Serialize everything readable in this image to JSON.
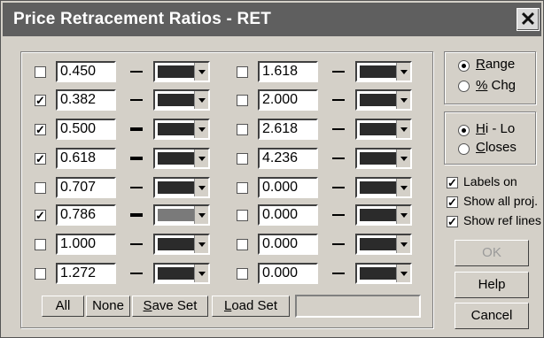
{
  "window": {
    "title": "Price Retracement Ratios - RET",
    "close_glyph": "✕"
  },
  "left_ratios": [
    {
      "checked": false,
      "value": "0.450",
      "line": "thin",
      "color": "#2b2b2b"
    },
    {
      "checked": true,
      "value": "0.382",
      "line": "thin",
      "color": "#2b2b2b"
    },
    {
      "checked": true,
      "value": "0.500",
      "line": "thick",
      "color": "#2b2b2b"
    },
    {
      "checked": true,
      "value": "0.618",
      "line": "thick",
      "color": "#2b2b2b"
    },
    {
      "checked": false,
      "value": "0.707",
      "line": "thin",
      "color": "#2b2b2b"
    },
    {
      "checked": true,
      "value": "0.786",
      "line": "thick",
      "color": "#7a7a7a"
    },
    {
      "checked": false,
      "value": "1.000",
      "line": "thin",
      "color": "#2b2b2b"
    },
    {
      "checked": false,
      "value": "1.272",
      "line": "thin",
      "color": "#2b2b2b"
    }
  ],
  "right_ratios": [
    {
      "checked": false,
      "value": "1.618",
      "line": "thin",
      "color": "#2b2b2b"
    },
    {
      "checked": false,
      "value": "2.000",
      "line": "thin",
      "color": "#2b2b2b"
    },
    {
      "checked": false,
      "value": "2.618",
      "line": "thin",
      "color": "#2b2b2b"
    },
    {
      "checked": false,
      "value": "4.236",
      "line": "thin",
      "color": "#2b2b2b"
    },
    {
      "checked": false,
      "value": "0.000",
      "line": "thin",
      "color": "#2b2b2b"
    },
    {
      "checked": false,
      "value": "0.000",
      "line": "thin",
      "color": "#2b2b2b"
    },
    {
      "checked": false,
      "value": "0.000",
      "line": "thin",
      "color": "#2b2b2b"
    },
    {
      "checked": false,
      "value": "0.000",
      "line": "thin",
      "color": "#2b2b2b"
    }
  ],
  "bottom_buttons": {
    "all": "All",
    "none": "None",
    "save_set": "Save Set",
    "load_set": "Load Set",
    "set_name": ""
  },
  "range_group": {
    "range": "Range",
    "pct_chg": "% Chg",
    "selected": "range"
  },
  "hilo_group": {
    "hi_lo": "Hi - Lo",
    "closes": "Closes",
    "selected": "hi_lo"
  },
  "options": [
    {
      "label": "Labels on",
      "checked": true
    },
    {
      "label": "Show all proj.",
      "checked": true
    },
    {
      "label": "Show ref lines",
      "checked": true
    }
  ],
  "actions": {
    "ok": "OK",
    "help": "Help",
    "cancel": "Cancel"
  }
}
